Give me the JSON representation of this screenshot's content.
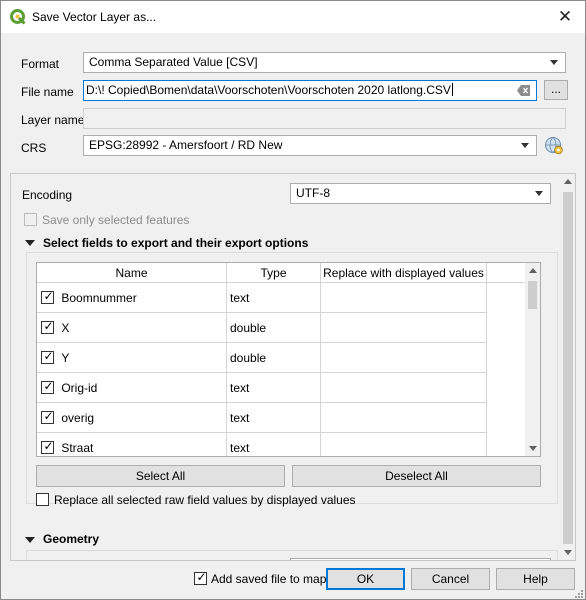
{
  "window": {
    "title": "Save Vector Layer as...",
    "close_glyph": "✕"
  },
  "form": {
    "format_label": "Format",
    "format_value": "Comma Separated Value [CSV]",
    "filename_label": "File name",
    "filename_value": "D:\\!  Copied\\Bomen\\data\\Voorschoten\\Voorschoten 2020 latlong.CSV",
    "browse_label": "...",
    "layername_label": "Layer name",
    "layername_value": "",
    "crs_label": "CRS",
    "crs_value": "EPSG:28992 - Amersfoort / RD New"
  },
  "options": {
    "encoding_label": "Encoding",
    "encoding_value": "UTF-8",
    "save_selected_label": "Save only selected features",
    "fields_section_title": "Select fields to export and their export options",
    "columns": [
      "Name",
      "Type",
      "Replace with displayed values"
    ],
    "rows": [
      {
        "name": "Boomnummer",
        "type": "text",
        "checked": true
      },
      {
        "name": "X",
        "type": "double",
        "checked": true
      },
      {
        "name": "Y",
        "type": "double",
        "checked": true
      },
      {
        "name": "Orig-id",
        "type": "text",
        "checked": true
      },
      {
        "name": "overig",
        "type": "text",
        "checked": true
      },
      {
        "name": "Straat",
        "type": "text",
        "checked": true
      }
    ],
    "select_all_label": "Select All",
    "deselect_all_label": "Deselect All",
    "replace_all_label": "Replace all selected raw field values by displayed values",
    "geometry_section_title": "Geometry"
  },
  "footer": {
    "add_saved_label": "Add saved file to map",
    "add_saved_checked": true,
    "ok_label": "OK",
    "cancel_label": "Cancel",
    "help_label": "Help"
  },
  "colors": {
    "accent": "#0078d7",
    "qgis_green": "#5a9e34"
  },
  "icons": {
    "app": "qgis-icon",
    "crs": "crs-globe-icon",
    "clear": "clear-text-icon"
  }
}
